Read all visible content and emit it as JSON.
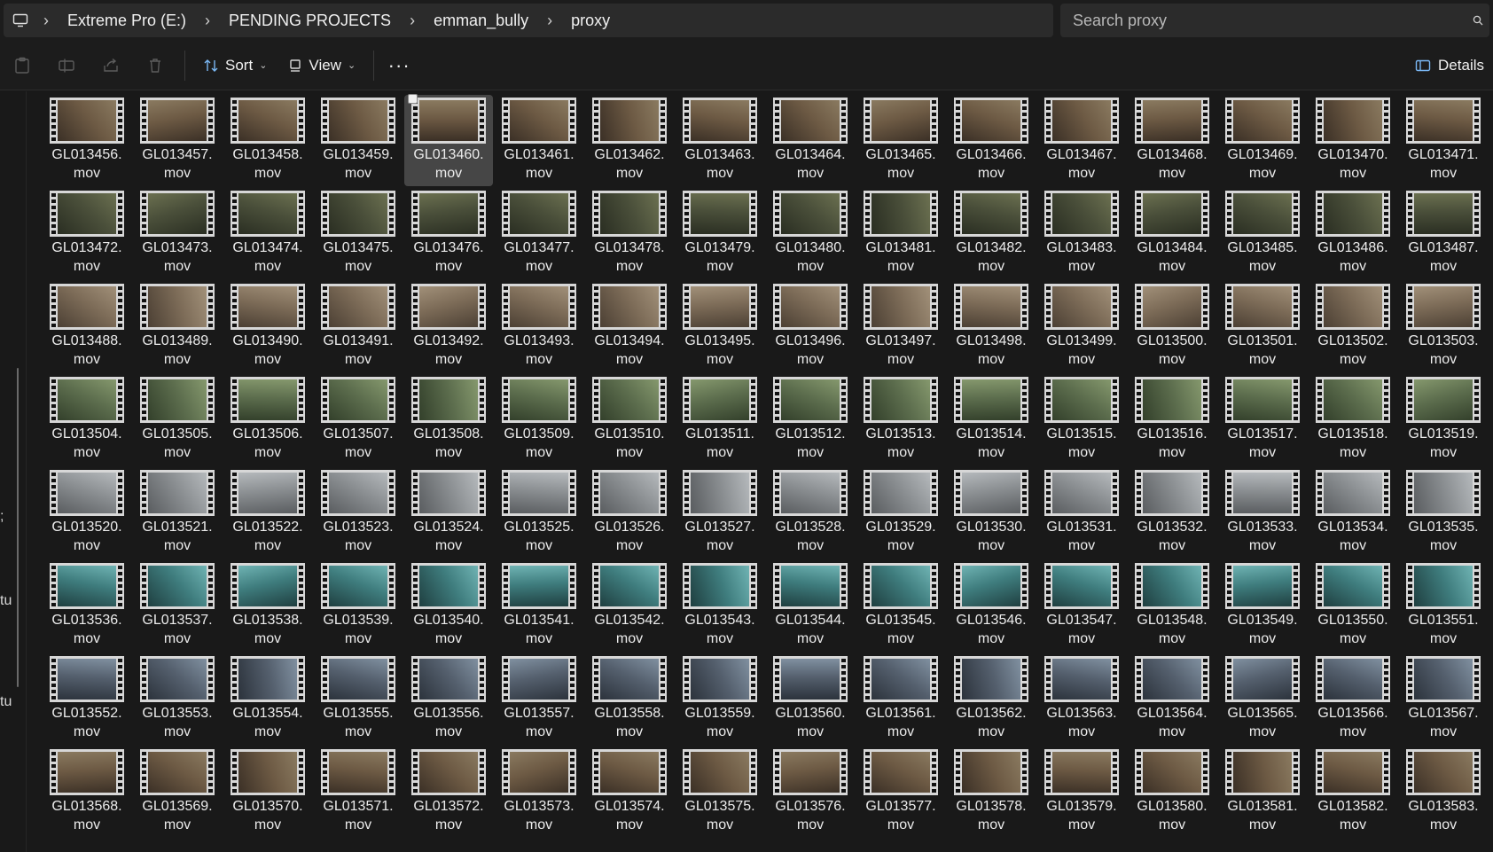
{
  "breadcrumb": {
    "items": [
      "Extreme Pro (E:)",
      "PENDING PROJECTS",
      "emman_bully",
      "proxy"
    ]
  },
  "search": {
    "placeholder": "Search proxy",
    "value": ""
  },
  "toolbar": {
    "sort_label": "Sort",
    "view_label": "View",
    "more_label": "···",
    "details_label": "Details"
  },
  "left_pane_fragments": [
    ";",
    "tu",
    "tu"
  ],
  "files": {
    "extension": "mov",
    "first_number": 13456,
    "last_number": 13583,
    "prefix": "GL0",
    "selected": "GL013460"
  },
  "colors": {
    "background": "#191919",
    "bar": "#2b2b2b",
    "selection": "#464646"
  }
}
